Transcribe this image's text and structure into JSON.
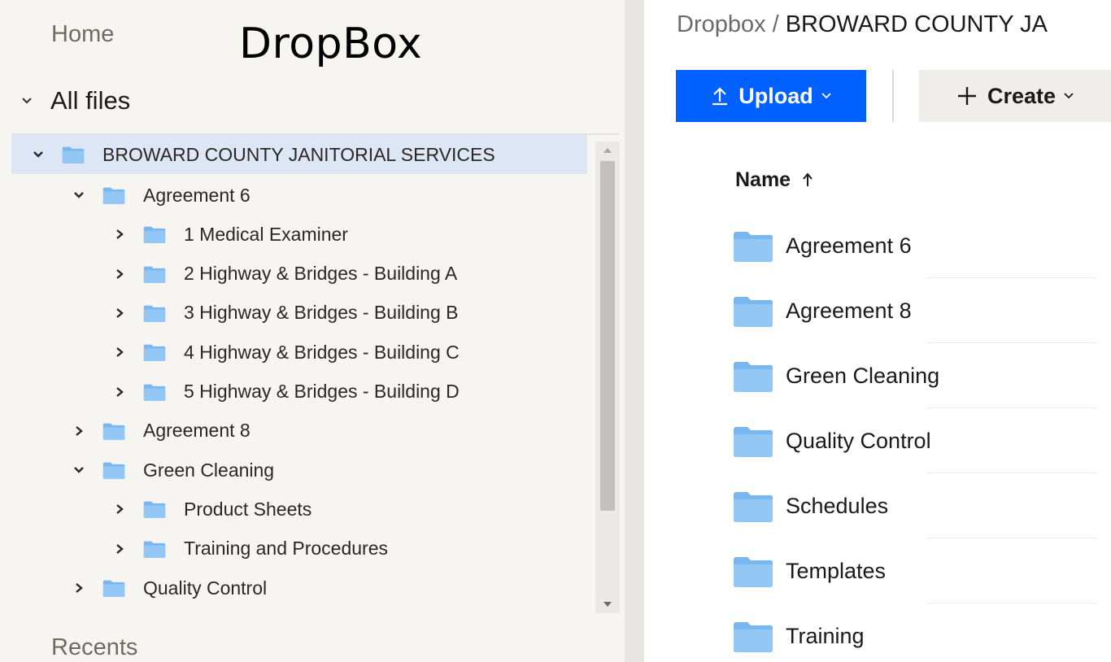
{
  "overlay_title": "DropBox",
  "sidebar": {
    "home_label": "Home",
    "all_files_label": "All files",
    "recents_label": "Recents",
    "tree": [
      {
        "label": "BROWARD COUNTY JANITORIAL SERVICES",
        "depth": 0,
        "expanded": true,
        "selected": true
      },
      {
        "label": "Agreement 6",
        "depth": 1,
        "expanded": true,
        "selected": false
      },
      {
        "label": "1 Medical Examiner",
        "depth": 2,
        "expanded": false,
        "selected": false
      },
      {
        "label": "2 Highway & Bridges - Building A",
        "depth": 2,
        "expanded": false,
        "selected": false
      },
      {
        "label": "3 Highway & Bridges - Building B",
        "depth": 2,
        "expanded": false,
        "selected": false
      },
      {
        "label": "4 Highway & Bridges - Building C",
        "depth": 2,
        "expanded": false,
        "selected": false
      },
      {
        "label": "5 Highway & Bridges - Building D",
        "depth": 2,
        "expanded": false,
        "selected": false
      },
      {
        "label": "Agreement 8",
        "depth": 1,
        "expanded": false,
        "selected": false
      },
      {
        "label": "Green Cleaning",
        "depth": 1,
        "expanded": true,
        "selected": false
      },
      {
        "label": "Product Sheets",
        "depth": 2,
        "expanded": false,
        "selected": false
      },
      {
        "label": "Training and Procedures",
        "depth": 2,
        "expanded": false,
        "selected": false
      },
      {
        "label": "Quality Control",
        "depth": 1,
        "expanded": false,
        "selected": false
      }
    ]
  },
  "breadcrumb": {
    "root": "Dropbox",
    "separator": "/",
    "current": "BROWARD COUNTY JA"
  },
  "toolbar": {
    "upload_label": "Upload",
    "create_label": "Create"
  },
  "list": {
    "name_header": "Name",
    "items": [
      {
        "label": "Agreement 6"
      },
      {
        "label": "Agreement 8"
      },
      {
        "label": "Green Cleaning"
      },
      {
        "label": "Quality Control"
      },
      {
        "label": "Schedules"
      },
      {
        "label": "Templates"
      },
      {
        "label": "Training"
      }
    ]
  },
  "colors": {
    "accent": "#0061fe",
    "folder": "#7ab6ef",
    "selected_row": "#dce6f5"
  },
  "icons": {
    "folder": "folder-icon",
    "expand": "chevron-right-icon",
    "collapse": "chevron-down-icon",
    "upload": "upload-arrow-icon",
    "create": "plus-icon",
    "sort": "sort-up-arrow-icon"
  }
}
